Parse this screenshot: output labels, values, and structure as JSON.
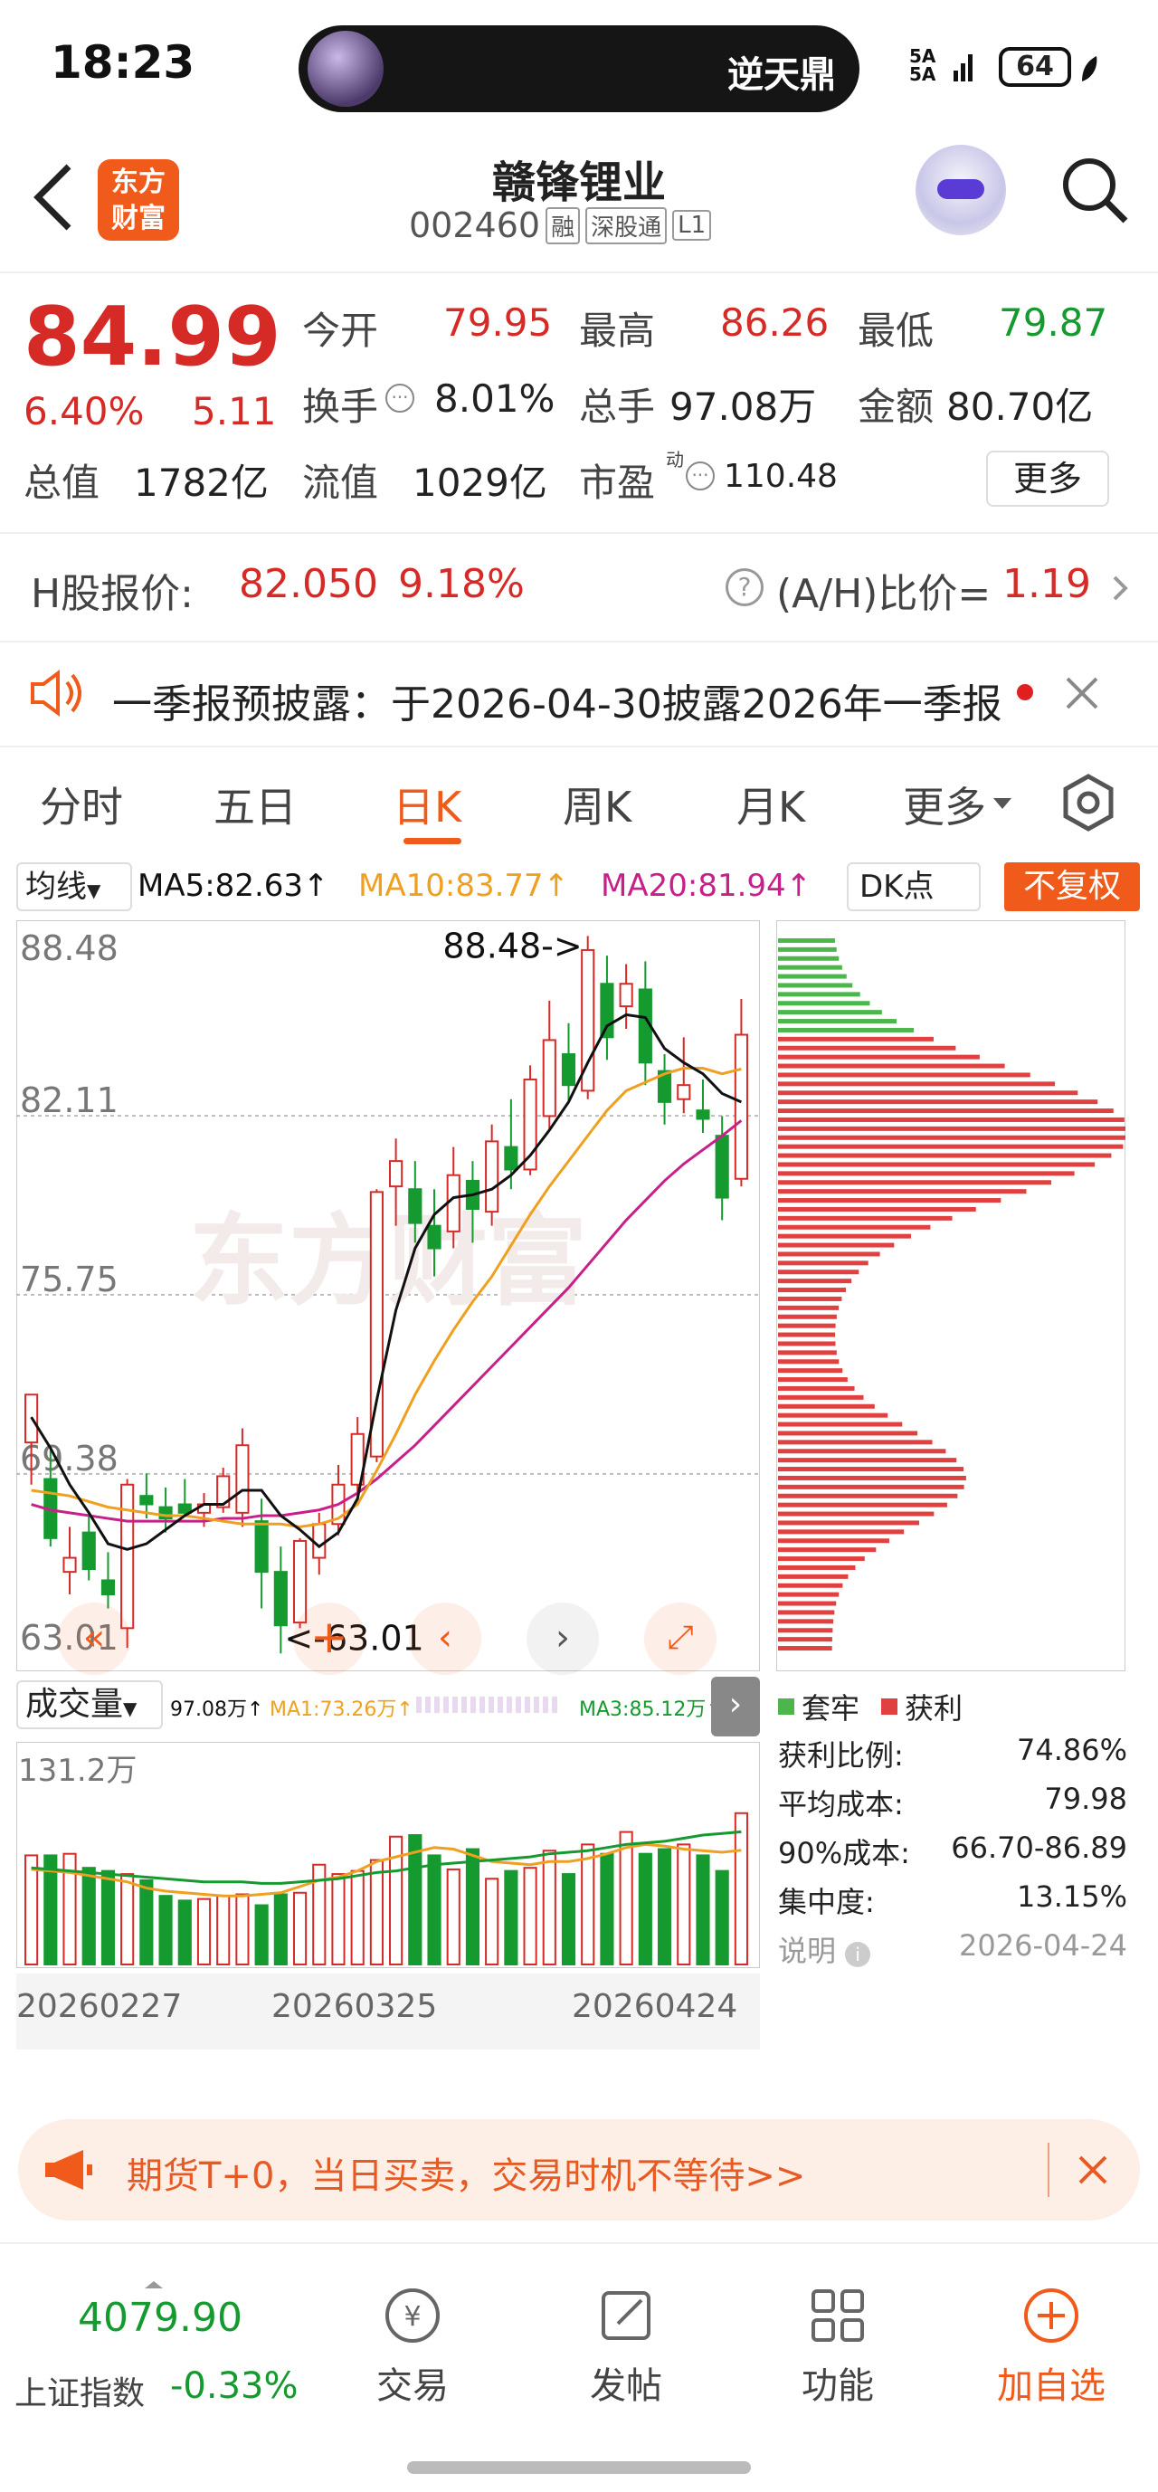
{
  "status_bar": {
    "time": "18:23",
    "live_title": "逆天鼎",
    "signal": "5A 5A",
    "battery": "64"
  },
  "header": {
    "back_icon": "back-arrow-icon",
    "brand": "东方\n财富",
    "stock_name": "赣锋锂业",
    "code": "002460",
    "tags": [
      "融",
      "深股通",
      "L1"
    ],
    "search_icon": "search-icon"
  },
  "quote": {
    "price": "84.99",
    "change_pct": "6.40%",
    "change_amt": "5.11",
    "open_label": "今开",
    "open": "79.95",
    "high_label": "最高",
    "high": "86.26",
    "low_label": "最低",
    "low": "79.87",
    "turnover_label": "换手",
    "turnover": "8.01%",
    "volume_label": "总手",
    "volume": "97.08万",
    "amount_label": "金额",
    "amount": "80.70亿",
    "mktcap_label": "总值",
    "mktcap": "1782亿",
    "float_label": "流值",
    "float": "1029亿",
    "pe_label": "市盈",
    "pe_sup": "动",
    "pe": "110.48",
    "more": "更多"
  },
  "h_share": {
    "label": "H股报价:",
    "price": "82.050",
    "pct": "9.18%",
    "ratio_label": "(A/H)比价=",
    "ratio": "1.19"
  },
  "notice": {
    "text": "一季报预披露：于2026-04-30披露2026年一季报"
  },
  "tabs": [
    "分时",
    "五日",
    "日K",
    "周K",
    "月K",
    "更多"
  ],
  "active_tab": "日K",
  "ma_bar": {
    "selector": "均线",
    "ma5": "MA5:82.63↑",
    "ma10": "MA10:83.77↑",
    "ma20": "MA20:81.94↑",
    "dk": "DK点",
    "fq": "不复权"
  },
  "price_axis": {
    "labels": [
      "88.48",
      "82.11",
      "75.75",
      "69.38",
      "63.01"
    ],
    "max_note": "88.48->",
    "min_note": "<-63.01",
    "watermark": "东方财富"
  },
  "volume_bar": {
    "selector": "成交量",
    "v": "97.08万↑",
    "ma1": "MA1:73.26万↑",
    "ma3": "MA3:85.12万↑",
    "axis_max": "131.2万"
  },
  "date_axis": [
    "20260227",
    "20260325",
    "20260424"
  ],
  "chip": {
    "legend_trap": "套牢",
    "legend_profit": "获利",
    "rows": [
      {
        "k": "获利比例:",
        "v": "74.86%"
      },
      {
        "k": "平均成本:",
        "v": "79.98"
      },
      {
        "k": "90%成本:",
        "v": "66.70-86.89"
      },
      {
        "k": "集中度:",
        "v": "13.15%"
      },
      {
        "k": "说明",
        "v": "2026-04-24"
      }
    ]
  },
  "banner": {
    "text": "期货T+0，当日买卖，交易时机不等待>>"
  },
  "bottom_nav": {
    "index_value": "4079.90",
    "index_name": "上证指数",
    "index_pct": "-0.33%",
    "items": [
      "交易",
      "发帖",
      "功能",
      "加自选"
    ]
  },
  "colors": {
    "up": "#d62a27",
    "down": "#159a2f",
    "accent": "#f05a1a",
    "ma5": "#111111",
    "ma10": "#f0a020",
    "ma20": "#c8208a"
  },
  "chart_data": {
    "type": "candlestick",
    "ylim": [
      63.01,
      88.48
    ],
    "candles": [
      {
        "o": 70.5,
        "h": 72.0,
        "l": 69.0,
        "c": 72.2
      },
      {
        "o": 69.2,
        "h": 70.3,
        "l": 66.8,
        "c": 67.1
      },
      {
        "o": 65.9,
        "h": 67.5,
        "l": 65.1,
        "c": 66.4
      },
      {
        "o": 67.3,
        "h": 68.0,
        "l": 65.6,
        "c": 66.0
      },
      {
        "o": 65.6,
        "h": 66.6,
        "l": 64.6,
        "c": 65.1
      },
      {
        "o": 63.9,
        "h": 69.2,
        "l": 63.2,
        "c": 69.0
      },
      {
        "o": 68.6,
        "h": 69.4,
        "l": 67.8,
        "c": 68.3
      },
      {
        "o": 68.2,
        "h": 68.9,
        "l": 67.3,
        "c": 67.8
      },
      {
        "o": 68.3,
        "h": 69.2,
        "l": 67.9,
        "c": 68.0
      },
      {
        "o": 68.0,
        "h": 68.7,
        "l": 67.5,
        "c": 68.3
      },
      {
        "o": 68.2,
        "h": 69.6,
        "l": 68.0,
        "c": 69.3
      },
      {
        "o": 68.0,
        "h": 71.0,
        "l": 67.5,
        "c": 70.4
      },
      {
        "o": 67.7,
        "h": 68.5,
        "l": 64.6,
        "c": 65.9
      },
      {
        "o": 65.9,
        "h": 66.8,
        "l": 63.0,
        "c": 64.0
      },
      {
        "o": 64.1,
        "h": 67.1,
        "l": 63.9,
        "c": 67.0
      },
      {
        "o": 66.4,
        "h": 68.0,
        "l": 65.8,
        "c": 67.6
      },
      {
        "o": 67.6,
        "h": 69.7,
        "l": 67.2,
        "c": 69.0
      },
      {
        "o": 69.0,
        "h": 71.4,
        "l": 68.7,
        "c": 70.8
      },
      {
        "o": 70.0,
        "h": 79.5,
        "l": 69.8,
        "c": 79.4
      },
      {
        "o": 79.6,
        "h": 81.3,
        "l": 78.2,
        "c": 80.5
      },
      {
        "o": 79.5,
        "h": 80.5,
        "l": 77.6,
        "c": 78.3
      },
      {
        "o": 78.2,
        "h": 79.5,
        "l": 76.4,
        "c": 77.4
      },
      {
        "o": 78.0,
        "h": 81.0,
        "l": 77.4,
        "c": 80.0
      },
      {
        "o": 79.8,
        "h": 80.5,
        "l": 77.6,
        "c": 78.8
      },
      {
        "o": 78.7,
        "h": 81.8,
        "l": 78.2,
        "c": 81.2
      },
      {
        "o": 81.0,
        "h": 82.7,
        "l": 79.5,
        "c": 80.2
      },
      {
        "o": 80.2,
        "h": 83.9,
        "l": 80.0,
        "c": 83.4
      },
      {
        "o": 82.1,
        "h": 86.2,
        "l": 81.6,
        "c": 84.8
      },
      {
        "o": 84.3,
        "h": 85.4,
        "l": 82.6,
        "c": 83.2
      },
      {
        "o": 83.0,
        "h": 88.5,
        "l": 82.7,
        "c": 88.0
      },
      {
        "o": 86.8,
        "h": 87.8,
        "l": 84.1,
        "c": 84.9
      },
      {
        "o": 86.0,
        "h": 87.5,
        "l": 85.2,
        "c": 86.8
      },
      {
        "o": 86.6,
        "h": 87.6,
        "l": 83.2,
        "c": 84.0
      },
      {
        "o": 83.7,
        "h": 84.3,
        "l": 81.8,
        "c": 82.6
      },
      {
        "o": 82.7,
        "h": 84.9,
        "l": 82.2,
        "c": 83.2
      },
      {
        "o": 82.3,
        "h": 83.4,
        "l": 81.5,
        "c": 82.0
      },
      {
        "o": 81.4,
        "h": 82.1,
        "l": 78.4,
        "c": 79.2
      },
      {
        "o": 79.87,
        "h": 86.26,
        "l": 79.6,
        "c": 84.99
      }
    ],
    "ma5": [
      71.4,
      70.3,
      69.0,
      68.0,
      66.9,
      66.7,
      66.9,
      67.4,
      67.9,
      68.3,
      68.3,
      68.8,
      68.8,
      67.9,
      67.4,
      66.8,
      67.3,
      68.5,
      72.0,
      75.2,
      77.4,
      78.6,
      79.2,
      79.3,
      79.5,
      80.0,
      80.7,
      81.6,
      82.6,
      84.0,
      85.3,
      85.7,
      85.6,
      84.5,
      84.0,
      83.6,
      82.9,
      82.6
    ],
    "ma10": [
      68.8,
      68.7,
      68.6,
      68.4,
      68.2,
      68.1,
      68.0,
      67.9,
      67.9,
      67.8,
      67.7,
      67.6,
      67.6,
      67.6,
      67.5,
      67.6,
      67.8,
      68.3,
      69.5,
      70.8,
      72.2,
      73.4,
      74.5,
      75.5,
      76.4,
      77.5,
      78.6,
      79.6,
      80.5,
      81.4,
      82.3,
      83.0,
      83.3,
      83.6,
      83.8,
      83.8,
      83.6,
      83.77
    ],
    "ma20": [
      68.3,
      68.1,
      68.0,
      67.9,
      67.8,
      67.7,
      67.7,
      67.7,
      67.7,
      67.7,
      67.8,
      67.8,
      67.9,
      67.9,
      68.0,
      68.1,
      68.3,
      68.7,
      69.2,
      69.8,
      70.4,
      71.1,
      71.8,
      72.5,
      73.2,
      73.9,
      74.6,
      75.3,
      76.0,
      76.8,
      77.6,
      78.4,
      79.1,
      79.8,
      80.4,
      80.9,
      81.4,
      81.94
    ],
    "volume": [
      70,
      70,
      71,
      62,
      60,
      58,
      54,
      44,
      41,
      42,
      44,
      45,
      38,
      45,
      46,
      64,
      58,
      60,
      67,
      82,
      83,
      70,
      61,
      74,
      55,
      60,
      62,
      73,
      58,
      77,
      71,
      85,
      71,
      74,
      77,
      70,
      60,
      97.08
    ],
    "vol_ma1": [
      61,
      60,
      59,
      57,
      55,
      53,
      49,
      47,
      46,
      45,
      44,
      44,
      45,
      46,
      50,
      54,
      56,
      60,
      66,
      69,
      72,
      75,
      74,
      70,
      66,
      65,
      64,
      66,
      66,
      68,
      71,
      75,
      77,
      76,
      74,
      73,
      72,
      73.26
    ],
    "vol_ma3": [
      62,
      61,
      60,
      59,
      58,
      57,
      56,
      55,
      54,
      53,
      53,
      53,
      52,
      52,
      53,
      54,
      55,
      57,
      59,
      60,
      62,
      64,
      65,
      66,
      67,
      68,
      69,
      71,
      72,
      73,
      75,
      77,
      78,
      79,
      81,
      83,
      84,
      85.12
    ],
    "chip_profile_note": "chip distribution shown as horizontal bars; green=trapped above price, red=profit below price"
  }
}
